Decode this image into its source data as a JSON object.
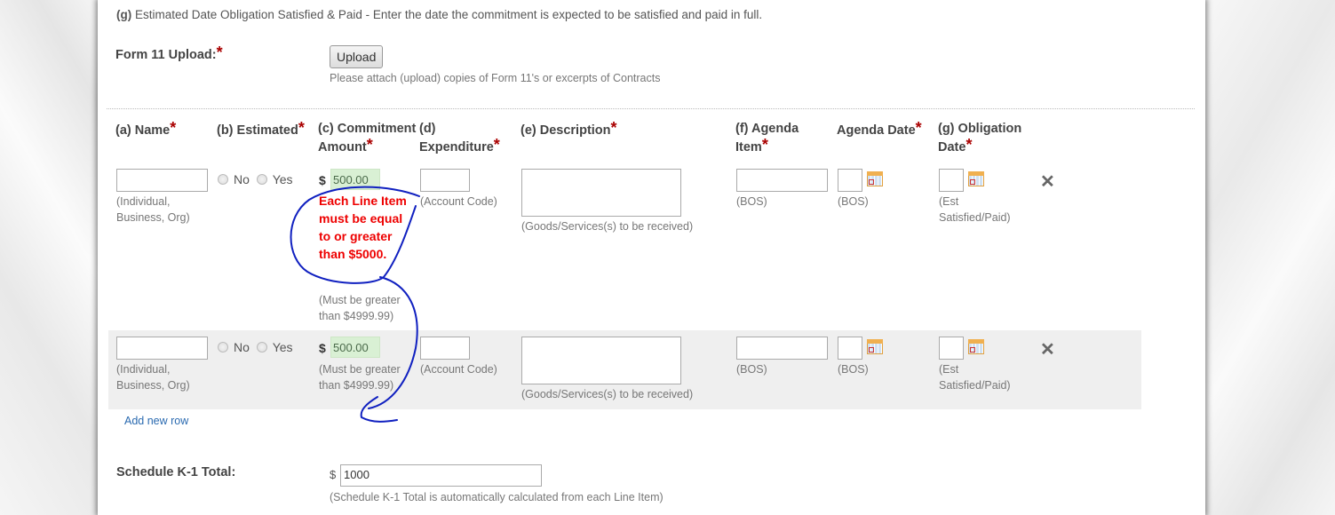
{
  "intro": {
    "label": "(g)",
    "text": "Estimated Date Obligation Satisfied & Paid - Enter the date the commitment is expected to be satisfied and paid in full."
  },
  "upload": {
    "label": "Form 11 Upload:",
    "required": "*",
    "button": "Upload",
    "hint": "Please attach (upload) copies of Form 11's or excerpts of Contracts"
  },
  "columns": [
    {
      "label": "(a) Name",
      "required": "*"
    },
    {
      "label": "(b) Estimated",
      "required": "*"
    },
    {
      "label_l1": "(c) Commitment",
      "label_l2": "Amount",
      "required": "*"
    },
    {
      "label_l1": "(d)",
      "label_l2": "Expenditure",
      "required": "*"
    },
    {
      "label": "(e) Description",
      "required": "*"
    },
    {
      "label_l1": "(f) Agenda",
      "label_l2": "Item",
      "required": "*"
    },
    {
      "label": "Agenda Date",
      "required": "*"
    },
    {
      "label_l1": "(g) Obligation",
      "label_l2": "Date",
      "required": "*"
    }
  ],
  "rows": [
    {
      "name_hint": "(Individual, Business, Org)",
      "radio_no": "No",
      "radio_yes": "Yes",
      "currency": "$",
      "amount": "500.00",
      "amount_error": "Each Line Item must be equal to or greater than $5000.",
      "amount_hint": "(Must be greater than $4999.99)",
      "expenditure_hint": "(Account Code)",
      "description_hint": "(Goods/Services(s) to be received)",
      "agenda_item_hint": "(BOS)",
      "agenda_date_hint": "(BOS)",
      "obligation_hint": "(Est Satisfied/Paid)",
      "remove": "✕"
    },
    {
      "name_hint": "(Individual, Business, Org)",
      "radio_no": "No",
      "radio_yes": "Yes",
      "currency": "$",
      "amount": "500.00",
      "amount_hint": "(Must be greater than $4999.99)",
      "expenditure_hint": "(Account Code)",
      "description_hint": "(Goods/Services(s) to be received)",
      "agenda_item_hint": "(BOS)",
      "agenda_date_hint": "(BOS)",
      "obligation_hint": "(Est Satisfied/Paid)",
      "remove": "✕"
    }
  ],
  "add_row": "Add new row",
  "total": {
    "label": "Schedule K-1 Total:",
    "currency": "$",
    "value": "1000",
    "hint": "(Schedule K-1 Total is automatically calculated from each Line Item)"
  },
  "annotation_color": "#1020c0"
}
